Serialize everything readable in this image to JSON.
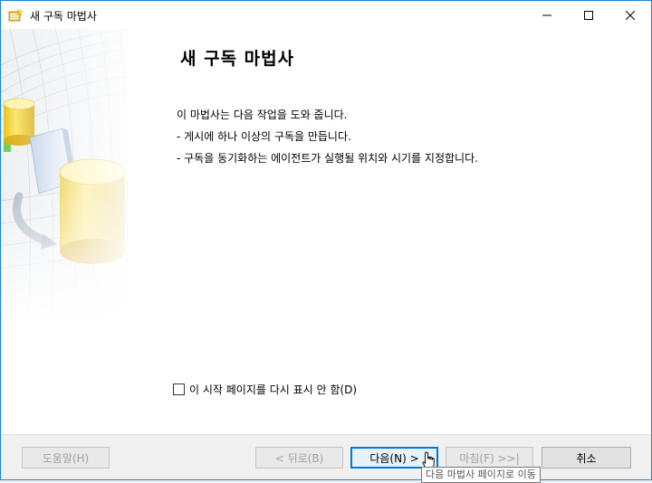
{
  "window": {
    "title": "새 구독 마법사",
    "controls": {
      "minimize": "—",
      "maximize": "☐",
      "close": "✕"
    }
  },
  "content": {
    "heading": "새 구독 마법사",
    "intro": "이 마법사는 다음 작업을 도와 줍니다.",
    "bullets": [
      "- 게시에 하나 이상의 구독을 만듭니다.",
      "- 구독을 동기화하는 에이전트가 실행될 위치와 시기를 지정합니다."
    ],
    "skip_checkbox": {
      "label": "이 시작 페이지를 다시 표시 안 함(D)",
      "checked": false
    }
  },
  "footer": {
    "help": "도움말(H)",
    "back": "< 뒤로(B)",
    "next": "다음(N) >",
    "finish": "마침(F) >>|",
    "cancel": "취소"
  },
  "tooltip": "다음 마법사 페이지로 이동",
  "colors": {
    "accent": "#0078d7",
    "window_border": "#1883d7",
    "cylinder": "#f5d437"
  }
}
